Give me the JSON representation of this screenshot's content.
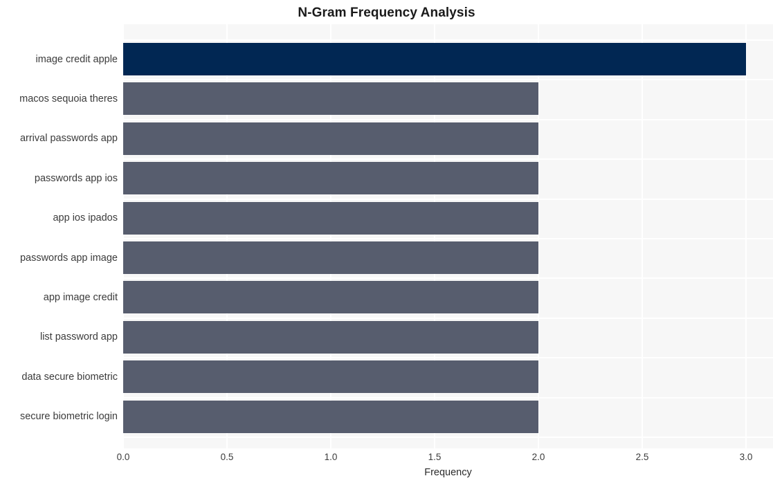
{
  "chart_data": {
    "type": "bar",
    "orientation": "horizontal",
    "title": "N-Gram Frequency Analysis",
    "xlabel": "Frequency",
    "ylabel": "",
    "xlim": [
      0.0,
      3.13
    ],
    "xticks": [
      "0.0",
      "0.5",
      "1.0",
      "1.5",
      "2.0",
      "2.5",
      "3.0"
    ],
    "xtick_values": [
      0.0,
      0.5,
      1.0,
      1.5,
      2.0,
      2.5,
      3.0
    ],
    "categories": [
      "image credit apple",
      "macos sequoia theres",
      "arrival passwords app",
      "passwords app ios",
      "app ios ipados",
      "passwords app image",
      "app image credit",
      "list password app",
      "data secure biometric",
      "secure biometric login"
    ],
    "values": [
      3,
      2,
      2,
      2,
      2,
      2,
      2,
      2,
      2,
      2
    ],
    "bar_colors": [
      "#012753",
      "#575d6e",
      "#575d6e",
      "#575d6e",
      "#575d6e",
      "#575d6e",
      "#575d6e",
      "#575d6e",
      "#575d6e",
      "#575d6e"
    ],
    "grid": true,
    "grid_color": "#ffffff",
    "plot_background": "#f7f7f7",
    "figure_background": "#ffffff",
    "legend": null
  }
}
